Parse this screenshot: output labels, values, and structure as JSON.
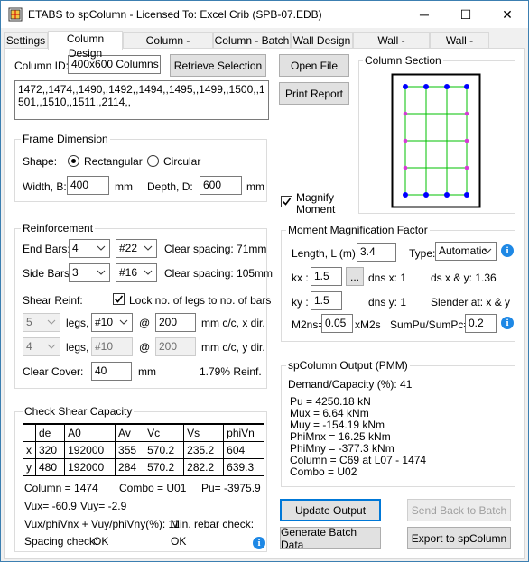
{
  "window": {
    "title": "ETABS to spColumn  - Licensed To: Excel Crib (SPB-07.EDB)",
    "minimize": "─",
    "maximize": "☐",
    "close": "✕"
  },
  "tabs": [
    "Settings",
    "Column Design",
    "Column - Summary",
    "Column - Batch",
    "Wall Design",
    "Wall - Summary",
    "Wall - Batch"
  ],
  "column_id": {
    "label": "Column ID:",
    "value": "400x600 Columns"
  },
  "buttons": {
    "retrieve": "Retrieve Selection",
    "open_file": "Open File",
    "print_report": "Print Report",
    "update_output": "Update Output",
    "send_back": "Send Back to Batch",
    "generate_batch": "Generate Batch Data",
    "export": "Export to spColumn",
    "ellipsis": "..."
  },
  "selection_list": "1472,,1474,,1490,,1492,,1494,,1495,,1499,,1500,,1501,,1510,,1511,,2114,,",
  "frame_dimension": {
    "title": "Frame Dimension",
    "shape_label": "Shape:",
    "rectangular": "Rectangular",
    "circular": "Circular",
    "width_label": "Width, B:",
    "width_value": "400",
    "width_unit": "mm",
    "depth_label": "Depth, D:",
    "depth_value": "600",
    "depth_unit": "mm"
  },
  "column_section": {
    "title": "Column Section"
  },
  "magnify": {
    "label_line1": "Magnify",
    "label_line2": "Moment"
  },
  "reinforcement": {
    "title": "Reinforcement",
    "end_bars_label": "End Bars:",
    "end_bars_count": "4",
    "end_bars_size": "#22",
    "end_clear": "Clear spacing: 71mm",
    "side_bars_label": "Side Bars:",
    "side_bars_count": "3",
    "side_bars_size": "#16",
    "side_clear": "Clear spacing: 105mm",
    "shear_label": "Shear Reinf:",
    "lock_label": "Lock no. of legs to no. of bars",
    "legs_x_count": "5",
    "legs_label": "legs,",
    "legs_x_size": "#10",
    "at": "@",
    "spacing_x": "200",
    "unit_x": "mm c/c, x dir.",
    "legs_y_count": "4",
    "legs_y_size": "#10",
    "spacing_y": "200",
    "unit_y": "mm c/c, y dir.",
    "cover_label": "Clear Cover:",
    "cover_value": "40",
    "cover_unit": "mm",
    "reinf_ratio": "1.79% Reinf."
  },
  "moment_magnification": {
    "title": "Moment Magnification Factor",
    "length_label": "Length, L (m):",
    "length_value": "3.4",
    "type_label": "Type:",
    "type_value": "Automatic",
    "kx_label": "kx :",
    "kx_value": "1.5",
    "dns_x": "dns x:  1",
    "ds_xy": "ds x & y:  1.36",
    "ky_label": "ky :",
    "ky_value": "1.5",
    "dns_y": "dns y:  1",
    "slender": "Slender at:  x  &  y",
    "m2ns_label": "M2ns=",
    "m2ns_value": "0.05",
    "m2ns_suffix": "xM2s",
    "sumpu_label": "SumPu/SumPc=",
    "sumpu_value": "0.2"
  },
  "spcolumn_output": {
    "title": "spColumn Output (PMM)",
    "demand_capacity": "Demand/Capacity (%):   41",
    "lines": [
      "Pu = 4250.18 kN",
      "Mux = 6.64 kNm",
      "Muy = -154.19 kNm",
      "PhiMnx = 16.25 kNm",
      "PhiMny = -377.3 kNm",
      "Column = C69 at L07 - 1474",
      "Combo = U02"
    ]
  },
  "shear_check": {
    "title": "Check Shear Capacity",
    "headers": [
      "",
      "de",
      "A0",
      "Av",
      "Vc",
      "Vs",
      "phiVn"
    ],
    "rows": [
      [
        "x",
        "320",
        "192000",
        "355",
        "570.2",
        "235.2",
        "604"
      ],
      [
        "y",
        "480",
        "192000",
        "284",
        "570.2",
        "282.2",
        "639.3"
      ]
    ],
    "column_text": "Column =   1474",
    "combo_text": "Combo =  U01",
    "pu_text": "Pu=   -3975.9",
    "vux_text": "Vux=  -60.9",
    "vuy_text": "Vuy=  -2.9",
    "ratio_text": "Vux/phiVnx + Vuy/phiVny(%): 11",
    "min_rebar": "Min. rebar check:",
    "spacing_check": "Spacing check:",
    "spacing_ok": "OK",
    "min_rebar_ok": "OK"
  },
  "colors": {
    "accent": "#0078d7",
    "bar_end": "#0000ff",
    "bar_side": "#d63bd6",
    "tie": "#00c000",
    "info": "#1e88e5"
  }
}
